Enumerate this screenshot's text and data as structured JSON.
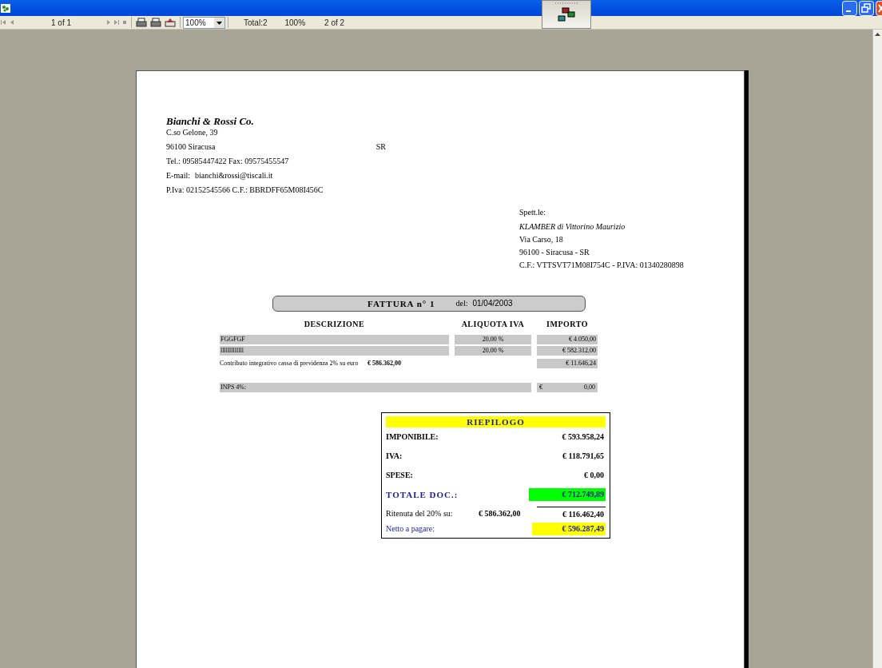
{
  "toolbar": {
    "page_indicator": "1 of 1",
    "zoom": "100%",
    "total": "Total:2",
    "zoom_status": "100%",
    "page_count": "2 of 2"
  },
  "sender": {
    "name": "Bianchi & Rossi Co.",
    "address": "C.so Gelone, 39",
    "city": "96100  Siracusa",
    "province": "SR",
    "phone": "Tel.:  09585447422 Fax: 09575455547",
    "email_label": "E-mail:",
    "email": "bianchi&rossi@tiscali.it",
    "tax_ids": "P.Iva: 02152545566   C.F.:  BBRDFF65M08I456C"
  },
  "recipient": {
    "label": "Spett.le:",
    "name": "KLAMBER di Vittorino Maurizio",
    "address": "Via Carso, 18",
    "city": "96100 - Siracusa - SR",
    "tax_ids": "C.F.: VTTSVT71M08I754C - P.IVA: 01340280898"
  },
  "invoice": {
    "title": "FATTURA  n° 1",
    "date_label": "del:",
    "date": "01/04/2003"
  },
  "table": {
    "columns": [
      "DESCRIZIONE",
      "ALIQUOTA IVA",
      "IMPORTO"
    ],
    "rows": [
      {
        "description": "FGGFGF",
        "vat": "20,00 %",
        "amount": "€ 4.050,00"
      },
      {
        "description": "lllllllllllll",
        "vat": "20,00 %",
        "amount": "€ 582.312,00"
      }
    ],
    "contribution": {
      "label": "Contributo integrativo cassa di previdenza 2% su euro",
      "base": "€ 586.362,00",
      "amount": "€ 11.646,24"
    },
    "inps": {
      "label": "INPS 4%:",
      "currency": "€",
      "amount": "0,00"
    }
  },
  "summary": {
    "title": "RIEPILOGO",
    "lines": [
      {
        "label": "IMPONIBILE:",
        "value": "€ 593.958,24",
        "kind": "plain"
      },
      {
        "label": "IVA:",
        "value": "€ 118.791,65",
        "kind": "plain"
      },
      {
        "label": "SPESE:",
        "value": "€ 0,00",
        "kind": "plain"
      },
      {
        "label": "TOTALE DOC.:",
        "value": "€ 712.749,89",
        "kind": "total",
        "color": "#00ff00"
      }
    ],
    "withholding": {
      "label": "Ritenuta del 20% su:",
      "base": "€ 586.362,00",
      "value": "€ 116.462,40"
    },
    "net": {
      "label": "Netto a pagare:",
      "value": "€ 596.287,49",
      "color": "#ffff00"
    }
  }
}
